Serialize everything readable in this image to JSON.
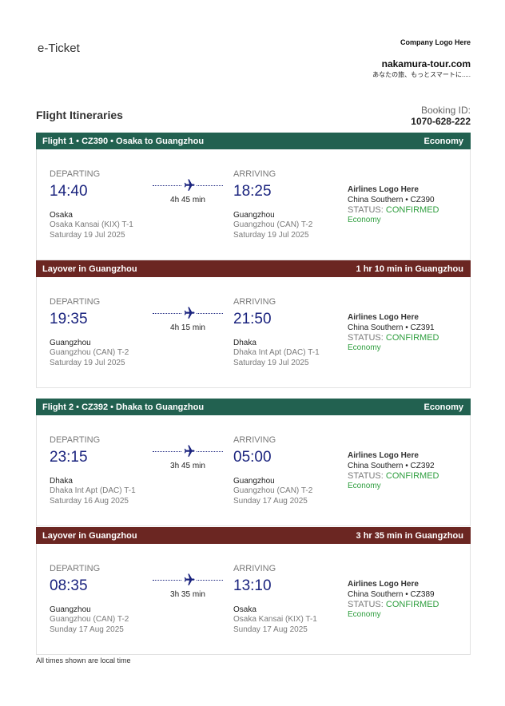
{
  "header": {
    "title": "e-Ticket",
    "company_logo": "Company Logo Here",
    "site": "nakamura-tour.com",
    "tagline": "あなたの旅、もっとスマートに....."
  },
  "itineraries_title": "Flight Itineraries",
  "booking": {
    "label": "Booking ID:",
    "id": "1070-628-222"
  },
  "bands": {
    "flight1": {
      "left": "Flight 1 • CZ390 • Osaka to Guangzhou",
      "right": "Economy"
    },
    "layover1": {
      "left": "Layover in Guangzhou",
      "right": "1 hr 10 min in Guangzhou"
    },
    "flight2": {
      "left": "Flight 2 • CZ392 • Dhaka to Guangzhou",
      "right": "Economy"
    },
    "layover2": {
      "left": "Layover in Guangzhou",
      "right": "3 hr 35 min in Guangzhou"
    }
  },
  "segments": [
    {
      "dep_label": "DEPARTING",
      "dep_time": "14:40",
      "dep_city": "Osaka",
      "dep_airport": "Osaka Kansai (KIX) T-1",
      "dep_date": "Saturday 19 Jul 2025",
      "duration": "4h 45 min",
      "arr_label": "ARRIVING",
      "arr_time": "18:25",
      "arr_city": "Guangzhou",
      "arr_airport": "Guangzhou (CAN) T-2",
      "arr_date": "Saturday 19 Jul 2025",
      "airline_logo": "Airlines Logo Here",
      "airline": "China Southern • CZ390",
      "status_label": "STATUS:",
      "status": "CONFIRMED",
      "cabin": "Economy"
    },
    {
      "dep_label": "DEPARTING",
      "dep_time": "19:35",
      "dep_city": "Guangzhou",
      "dep_airport": "Guangzhou (CAN) T-2",
      "dep_date": "Saturday 19 Jul 2025",
      "duration": "4h 15 min",
      "arr_label": "ARRIVING",
      "arr_time": "21:50",
      "arr_city": "Dhaka",
      "arr_airport": "Dhaka Int Apt (DAC) T-1",
      "arr_date": "Saturday 19 Jul 2025",
      "airline_logo": "Airlines Logo Here",
      "airline": "China Southern • CZ391",
      "status_label": "STATUS:",
      "status": "CONFIRMED",
      "cabin": "Economy"
    },
    {
      "dep_label": "DEPARTING",
      "dep_time": "23:15",
      "dep_city": "Dhaka",
      "dep_airport": "Dhaka Int Apt (DAC) T-1",
      "dep_date": "Saturday 16 Aug 2025",
      "duration": "3h 45 min",
      "arr_label": "ARRIVING",
      "arr_time": "05:00",
      "arr_city": "Guangzhou",
      "arr_airport": "Guangzhou (CAN) T-2",
      "arr_date": "Sunday 17 Aug 2025",
      "airline_logo": "Airlines Logo Here",
      "airline": "China Southern • CZ392",
      "status_label": "STATUS:",
      "status": "CONFIRMED",
      "cabin": "Economy"
    },
    {
      "dep_label": "DEPARTING",
      "dep_time": "08:35",
      "dep_city": "Guangzhou",
      "dep_airport": "Guangzhou (CAN) T-2",
      "dep_date": "Sunday 17 Aug 2025",
      "duration": "3h 35 min",
      "arr_label": "ARRIVING",
      "arr_time": "13:10",
      "arr_city": "Osaka",
      "arr_airport": "Osaka Kansai (KIX) T-1",
      "arr_date": "Sunday 17 Aug 2025",
      "airline_logo": "Airlines Logo Here",
      "airline": "China Southern • CZ389",
      "status_label": "STATUS:",
      "status": "CONFIRMED",
      "cabin": "Economy"
    }
  ],
  "icons": {
    "route": "airplane-icon"
  },
  "colors": {
    "flight_band": "#226150",
    "layover_band": "#6b2622",
    "time": "#1a237e",
    "confirmed": "#2e9e3e"
  },
  "footer": "All times shown are local time"
}
